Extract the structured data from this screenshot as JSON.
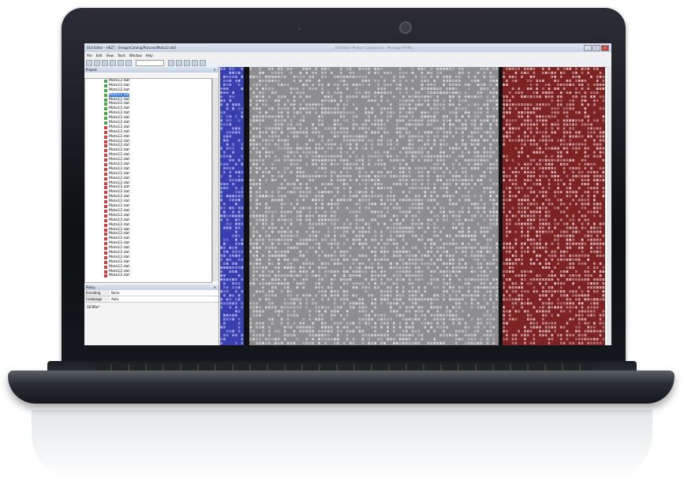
{
  "window": {
    "title": "010 Editor - HKZT - [Image/Catalog/Pictures/Moto12.dat]",
    "center_title": "010 Editor Product Comparison - Message (HTML)",
    "min": "_",
    "max": "□",
    "close": "×"
  },
  "menu": [
    "File",
    "Edit",
    "View",
    "Tools",
    "Window",
    "Help"
  ],
  "panel": {
    "title": "Project",
    "close": "×"
  },
  "tree_items": [
    {
      "label": "Moto12.dat",
      "color": "#4aa84a"
    },
    {
      "label": "Moto12.dat",
      "color": "#4aa84a"
    },
    {
      "label": "Moto12.dat",
      "color": "#4aa84a"
    },
    {
      "label": "Moto12.dat",
      "color": "#4aa84a",
      "selected": true
    },
    {
      "label": "Moto12.dat",
      "color": "#4aa84a"
    },
    {
      "label": "Moto12.dat",
      "color": "#4aa84a"
    },
    {
      "label": "Moto12.dat",
      "color": "#4aa84a"
    },
    {
      "label": "Moto12.dat",
      "color": "#4aa84a"
    },
    {
      "label": "Moto12.dat",
      "color": "#4aa84a"
    },
    {
      "label": "Moto12.dat",
      "color": "#4aa84a"
    },
    {
      "label": "Moto12.dat",
      "color": "#d04040"
    },
    {
      "label": "Moto12.dat",
      "color": "#d04040"
    },
    {
      "label": "Moto12.dat",
      "color": "#d04040"
    },
    {
      "label": "Moto12.dat",
      "color": "#d04040"
    },
    {
      "label": "Moto12.dat",
      "color": "#d04040"
    },
    {
      "label": "Moto12.dat",
      "color": "#d04040"
    },
    {
      "label": "Moto12.dat",
      "color": "#d04040"
    },
    {
      "label": "Moto12.dat",
      "color": "#d04040"
    },
    {
      "label": "Moto12.dat",
      "color": "#d04040"
    },
    {
      "label": "Moto12.dat",
      "color": "#d04040"
    },
    {
      "label": "Moto12.dat",
      "color": "#d04040"
    },
    {
      "label": "Moto12.dat",
      "color": "#d04040"
    },
    {
      "label": "Moto12.dat",
      "color": "#d04040"
    },
    {
      "label": "Moto12.dat",
      "color": "#d04040"
    },
    {
      "label": "Moto12.dat",
      "color": "#d04040"
    },
    {
      "label": "Moto12.dat",
      "color": "#d04040"
    },
    {
      "label": "Moto12.dat",
      "color": "#d04040"
    },
    {
      "label": "Moto12.dat",
      "color": "#d04040"
    },
    {
      "label": "Moto12.dat",
      "color": "#d04040"
    },
    {
      "label": "Moto12.dat",
      "color": "#d04040"
    },
    {
      "label": "Moto12.dat",
      "color": "#d04040"
    },
    {
      "label": "Moto12.dat",
      "color": "#d04040"
    },
    {
      "label": "Moto12.dat",
      "color": "#d04040"
    },
    {
      "label": "Moto12.dat",
      "color": "#d04040"
    },
    {
      "label": "Moto12.dat",
      "color": "#d04040"
    },
    {
      "label": "Moto12.dat",
      "color": "#d04040"
    },
    {
      "label": "Moto12.dat",
      "color": "#d04040"
    },
    {
      "label": "Moto12.dat",
      "color": "#d04040"
    },
    {
      "label": "Moto12.dat",
      "color": "#d04040"
    },
    {
      "label": "Moto12.dat",
      "color": "#d04040"
    },
    {
      "label": "Moto12.dat",
      "color": "#d04040"
    },
    {
      "label": "Moto12.dat",
      "color": "#d04040"
    },
    {
      "label": "Moto12.dat",
      "color": "#d04040"
    }
  ],
  "properties": {
    "title": "Policy",
    "close": "×",
    "rows": [
      {
        "key": "Encoding",
        "value": "None"
      },
      {
        "key": "Codepage",
        "value": "Auto"
      }
    ],
    "value_text": "GIF89a*"
  },
  "colors": {
    "address_bg": "#3a3fb0",
    "hex_bg": "#8e8e90",
    "ascii_bg": "#7e2323"
  }
}
